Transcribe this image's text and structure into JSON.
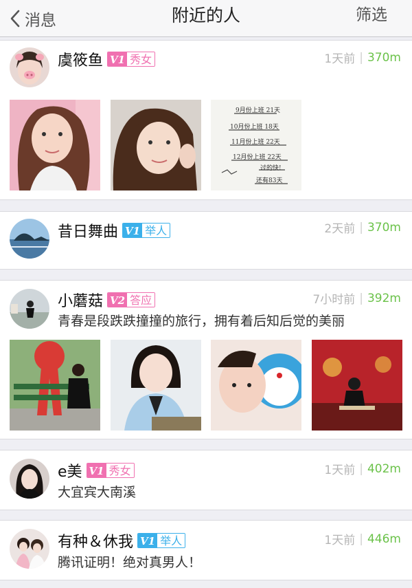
{
  "nav": {
    "back_label": "消息",
    "title": "附近的人",
    "filter_label": "筛选"
  },
  "colors": {
    "accent_green": "#6bc24a",
    "badge_pink": "#f070b0",
    "badge_blue": "#3bb0ea"
  },
  "users": [
    {
      "name": "虞筱鱼",
      "level": "V1",
      "tag": "秀女",
      "badge_color": "pink",
      "time": "1天前",
      "distance": "370m",
      "signature": "",
      "photos": 3
    },
    {
      "name": "昔日舞曲",
      "level": "V1",
      "tag": "举人",
      "badge_color": "blue",
      "time": "2天前",
      "distance": "370m",
      "signature": "",
      "photos": 0
    },
    {
      "name": "小蘑菇",
      "level": "V2",
      "tag": "答应",
      "badge_color": "pink",
      "time": "7小时前",
      "distance": "392m",
      "signature": "青春是段跌跌撞撞的旅行，拥有着后知后觉的美丽",
      "photos": 4
    },
    {
      "name": "e美",
      "level": "V1",
      "tag": "秀女",
      "badge_color": "pink",
      "time": "1天前",
      "distance": "402m",
      "signature": "大宜宾大南溪",
      "photos": 0
    },
    {
      "name": "有种＆休我",
      "level": "V1",
      "tag": "举人",
      "badge_color": "blue",
      "time": "1天前",
      "distance": "446m",
      "signature": "腾讯证明！绝对真男人！",
      "photos": 0
    }
  ],
  "note_photo_text": [
    "9月份上班 21天",
    "10月份上班 18天",
    "11月份上班 22天",
    "12月份上班 22天",
    "过的快!",
    "还有83天"
  ]
}
